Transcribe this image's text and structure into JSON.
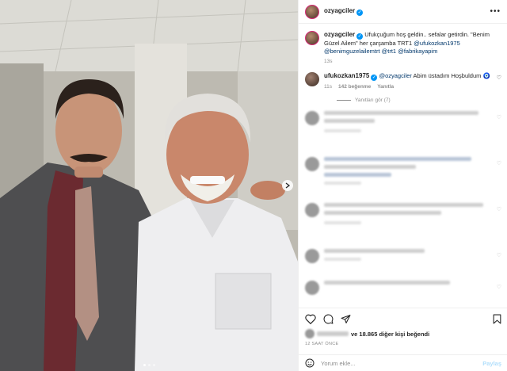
{
  "post": {
    "author": "ozyagciler",
    "caption_text": "Ufukçuğum hoş geldin.. sefalar getirdin. \"Benim Güzel Ailem\" her çarşamba TRT1",
    "caption_links": [
      "@ufukozkan1975",
      "@benimguzelailemtrt",
      "@trt1",
      "@fabrikayapim"
    ],
    "caption_time": "13s"
  },
  "reply": {
    "author": "ufukozkan1975",
    "mention": "@ozyagciler",
    "text": "Abim üstadım Hoşbuldum",
    "emoji": "🧿",
    "time": "11s",
    "likes": "142 beğenme",
    "reply_label": "Yanıtla",
    "see_replies": "Yanıtları gör (7)"
  },
  "stats": {
    "likes_text": "ve 18.865 diğer kişi beğendi",
    "time": "12 SAAT ÖNCE"
  },
  "comment_box": {
    "placeholder": "Yorum ekle...",
    "post_label": "Paylaş"
  },
  "icons": [
    "more-icon",
    "heart-icon",
    "comment-icon",
    "share-icon",
    "bookmark-icon",
    "emoji-icon",
    "chevron-right-icon"
  ]
}
